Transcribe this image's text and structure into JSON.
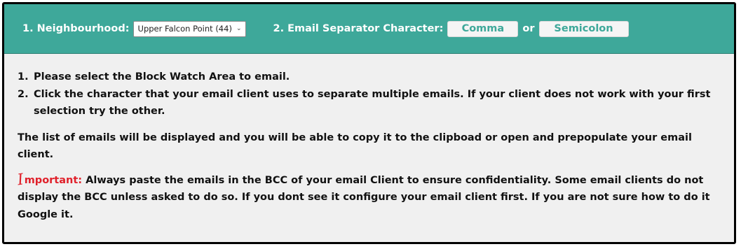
{
  "toolbar": {
    "neighbourhood_label": "1. Neighbourhood:",
    "neighbourhood_selected": "Upper Falcon Point (44)",
    "separator_label": "2. Email Separator Character:",
    "comma_button": "Comma",
    "or_text": "or",
    "semicolon_button": "Semicolon"
  },
  "instructions": {
    "step1_num": "1.",
    "step1": "Please select the Block Watch Area to email.",
    "step2_num": "2.",
    "step2": "Click the character that your email client uses to separate multiple emails. If your client does not work with your first selection try the other."
  },
  "info_text": "The list of emails will be displayed and you will be able to copy it to the clipboad or open and prepopulate your email client.",
  "important": {
    "initial": "I",
    "word": "mportant:",
    "text": "Always paste the emails in the BCC of your email Client to ensure confidentiality. Some email clients do not display the BCC unless asked to do so. If you dont see it configure your email client first. If you are not sure how to do it Google it."
  },
  "colors": {
    "header": "#3ea89a",
    "important": "#e0212b"
  }
}
